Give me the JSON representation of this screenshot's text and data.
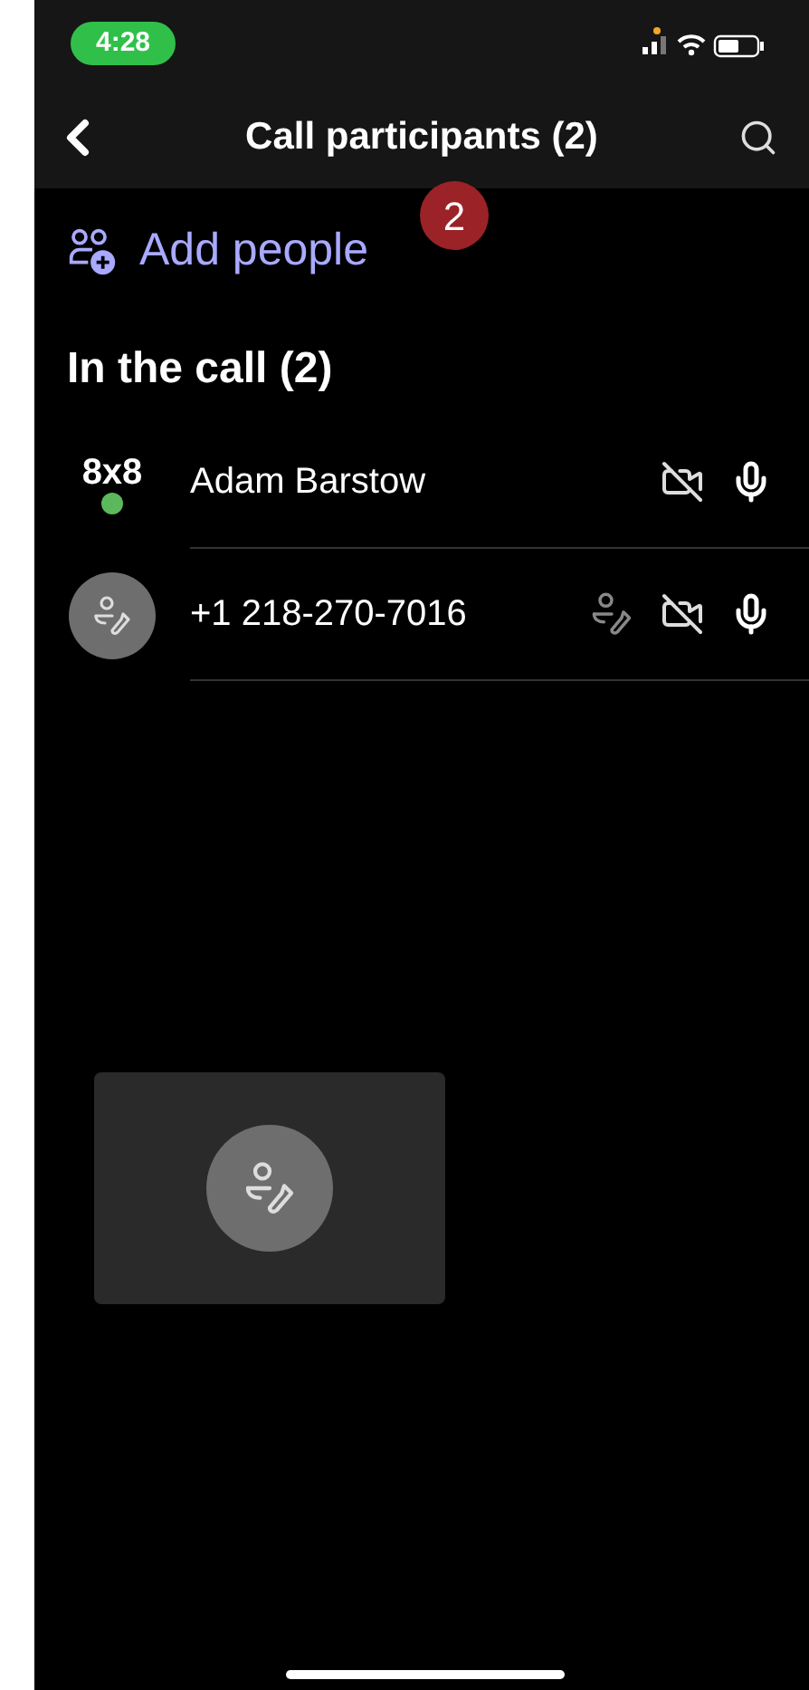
{
  "status_bar": {
    "time": "4:28"
  },
  "header": {
    "title": "Call participants (2)"
  },
  "annotation": {
    "badge": "2"
  },
  "add_people": {
    "label": "Add people"
  },
  "section": {
    "title": "In the call (2)"
  },
  "participants": [
    {
      "kind": "logo",
      "logo": "8x8",
      "name": "Adam Barstow",
      "online": true,
      "phone_icon": false,
      "video_off": true,
      "mic_on": true
    },
    {
      "kind": "phone",
      "name": "+1 218-270-7016",
      "online": false,
      "phone_icon": true,
      "video_off": true,
      "mic_on": true
    }
  ],
  "tile": {
    "kind": "phone"
  }
}
